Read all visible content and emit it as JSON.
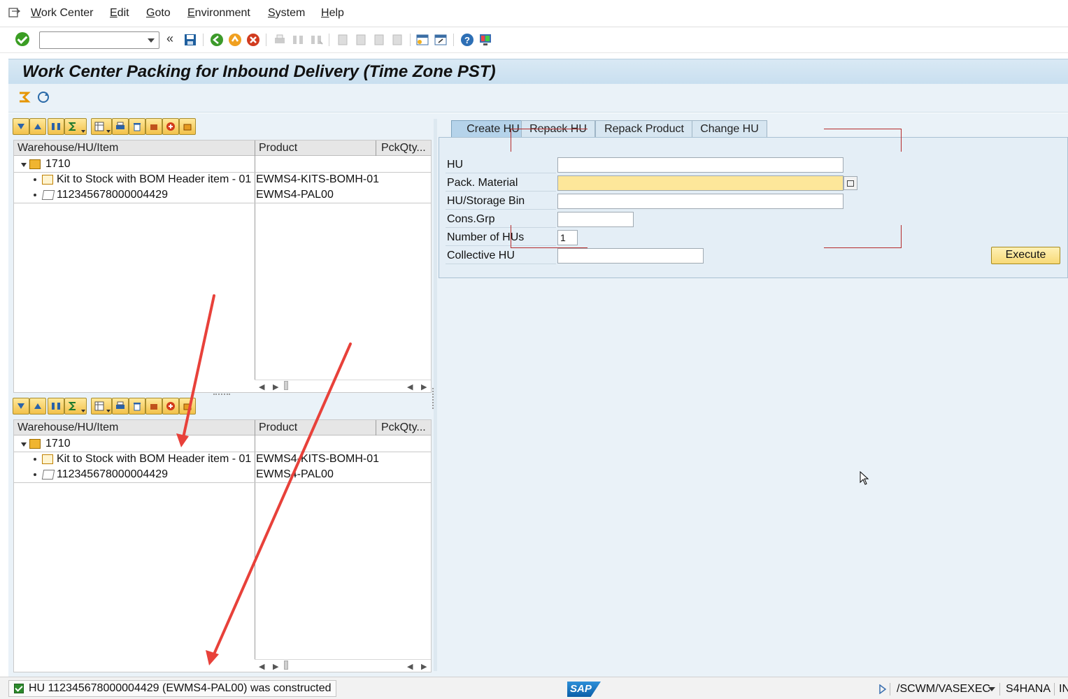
{
  "menu": {
    "items": [
      {
        "label": "Work Center"
      },
      {
        "label": "Edit"
      },
      {
        "label": "Goto"
      },
      {
        "label": "Environment"
      },
      {
        "label": "System"
      },
      {
        "label": "Help"
      }
    ]
  },
  "toolbar": {
    "command_value": "",
    "icons": [
      "enter-icon",
      "command-field",
      "back-nav-icon",
      "save-icon",
      "back-icon",
      "exit-icon",
      "cancel-icon",
      "print-icon",
      "find-icon",
      "find-next-icon",
      "first-page-icon",
      "previous-page-icon",
      "next-page-icon",
      "last-page-icon",
      "create-session-icon",
      "generate-shortcut-icon",
      "help-icon",
      "customize-layout-icon"
    ]
  },
  "title": "Work Center Packing for Inbound Delivery (Time Zone PST)",
  "app_toolbar": {
    "icons": [
      "switch-work-center-icon",
      "refresh-icon"
    ]
  },
  "tree_pane_toolbar_icons": [
    "expand-all-icon",
    "collapse-all-icon",
    "find-icon",
    "sum-icon",
    "layout-icon",
    "print-icon",
    "delete-icon",
    "pack-icon",
    "unpack-icon",
    "hu-icon"
  ],
  "tree_top": {
    "headers": {
      "col1": "Warehouse/HU/Item",
      "col2": "Product",
      "col3": "PckQty..."
    },
    "rows": [
      {
        "label": "1710",
        "product": ""
      },
      {
        "label": "Kit to Stock with BOM Header item - 01",
        "product": "EWMS4-KITS-BOMH-01"
      },
      {
        "label": "112345678000004429",
        "product": "EWMS4-PAL00"
      }
    ]
  },
  "tree_bottom": {
    "headers": {
      "col1": "Warehouse/HU/Item",
      "col2": "Product",
      "col3": "PckQty..."
    },
    "rows": [
      {
        "label": "1710",
        "product": ""
      },
      {
        "label": "Kit to Stock with BOM Header item - 01",
        "product": "EWMS4-KITS-BOMH-01"
      },
      {
        "label": "112345678000004429",
        "product": "EWMS4-PAL00"
      }
    ]
  },
  "tabs": [
    {
      "label": "Create HU",
      "active": true
    },
    {
      "label": "Repack HU",
      "active": false
    },
    {
      "label": "Repack Product",
      "active": false
    },
    {
      "label": "Change HU",
      "active": false
    }
  ],
  "form": {
    "hu": {
      "label": "HU",
      "value": ""
    },
    "pack_material": {
      "label": "Pack. Material",
      "value": ""
    },
    "hu_storage_bin": {
      "label": "HU/Storage Bin",
      "value": ""
    },
    "cons_grp": {
      "label": "Cons.Grp",
      "value": ""
    },
    "number_of_hus": {
      "label": "Number of HUs",
      "value": "1"
    },
    "collective_hu": {
      "label": "Collective HU",
      "value": ""
    },
    "execute_label": "Execute"
  },
  "status": {
    "message": "HU 112345678000004429 (EWMS4-PAL00) was constructed",
    "transaction": "/SCWM/VASEXEC",
    "system": "S4HANA",
    "extra": "IN",
    "logo": "SAP"
  },
  "colors": {
    "title_bg": "#c9dff0",
    "required_field": "#fde79a",
    "button_gold": "#f7d977",
    "annotation_arrow": "#e8413a"
  }
}
